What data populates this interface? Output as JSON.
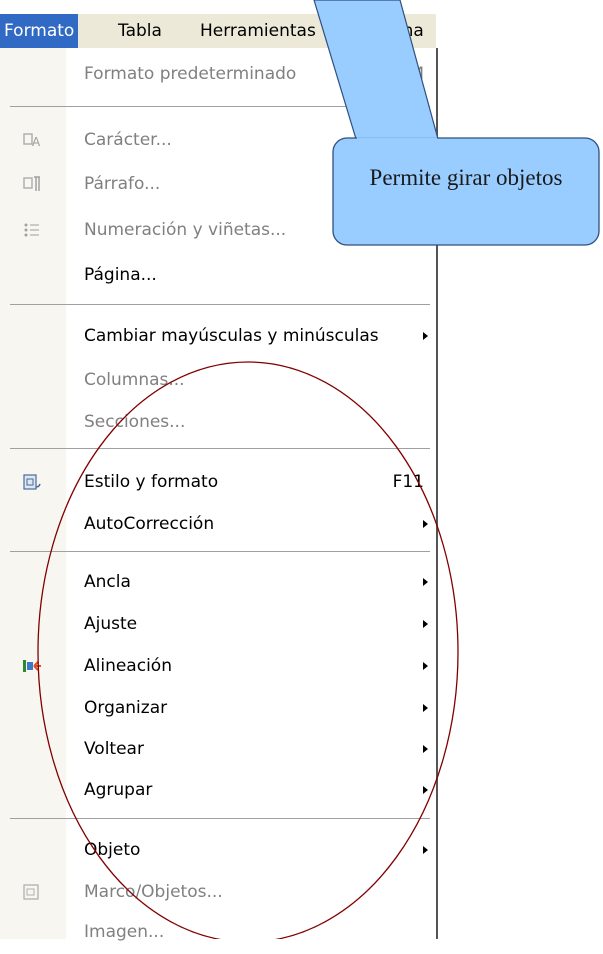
{
  "menubar": {
    "items": [
      {
        "label": "Formato",
        "active": true
      },
      {
        "label": "Tabla"
      },
      {
        "label": "Herramientas"
      },
      {
        "label": "Ventana"
      }
    ]
  },
  "menu": {
    "items": [
      {
        "label": "Formato predeterminado",
        "shortcut": "Ctrl+M",
        "disabled": true
      },
      {
        "label": "Carácter...",
        "disabled": true,
        "icon": "character-icon"
      },
      {
        "label": "Párrafo...",
        "disabled": true,
        "icon": "paragraph-icon"
      },
      {
        "label": "Numeración y viñetas...",
        "disabled": true,
        "icon": "bullets-icon"
      },
      {
        "label": "Página..."
      },
      {
        "label": "Cambiar mayúsculas y minúsculas",
        "submenu": true
      },
      {
        "label": "Columnas...",
        "disabled": true
      },
      {
        "label": "Secciones...",
        "disabled": true
      },
      {
        "label": "Estilo y formato",
        "shortcut": "F11",
        "icon": "styles-icon"
      },
      {
        "label": "AutoCorrección",
        "submenu": true
      },
      {
        "label": "Ancla",
        "submenu": true
      },
      {
        "label": "Ajuste",
        "submenu": true
      },
      {
        "label": "Alineación",
        "submenu": true,
        "icon": "alignment-icon"
      },
      {
        "label": "Organizar",
        "submenu": true
      },
      {
        "label": "Voltear",
        "submenu": true
      },
      {
        "label": "Agrupar",
        "submenu": true
      },
      {
        "label": "Objeto",
        "submenu": true
      },
      {
        "label": "Marco/Objetos...",
        "disabled": true,
        "icon": "frame-icon"
      },
      {
        "label": "Imagen...",
        "disabled": true
      }
    ]
  },
  "callout": {
    "text": "Permite girar objetos"
  },
  "colors": {
    "menubar_bg": "#ece9d8",
    "menubar_active": "#316ac5",
    "callout_fill": "#99ccff",
    "disabled_text": "#808080",
    "ellipse_stroke": "#800000"
  }
}
